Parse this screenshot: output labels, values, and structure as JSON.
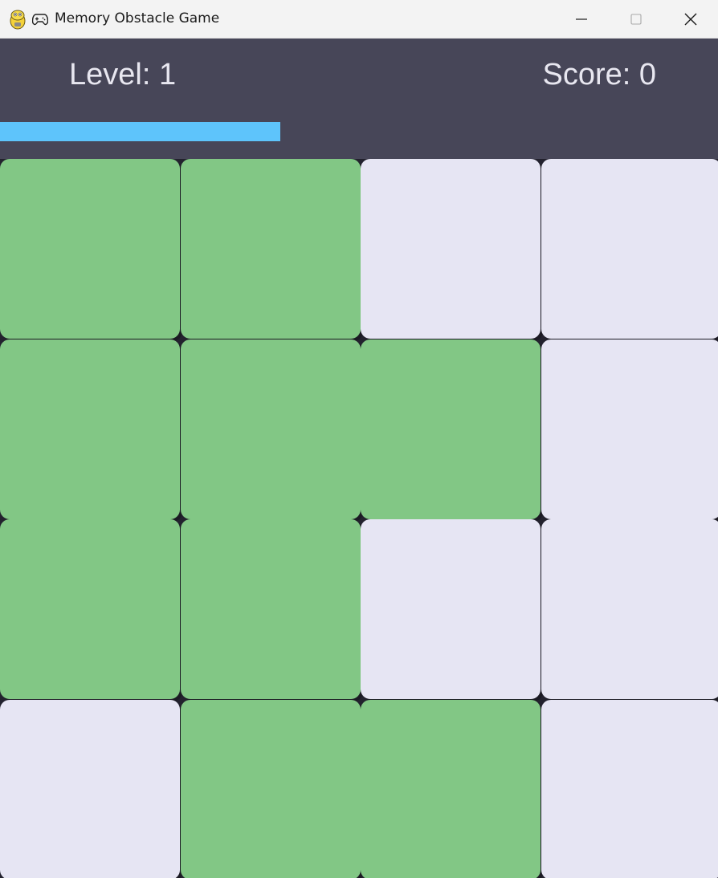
{
  "window": {
    "title": "Memory Obstacle Game",
    "app_icon": "pygame-snake-icon",
    "title_icon": "gamepad-icon",
    "controls": [
      "minimize-icon",
      "maximize-icon",
      "close-icon"
    ]
  },
  "hud": {
    "level_text": "Level: 1",
    "score_text": "Score: 0",
    "timer_progress": 0.39,
    "timer_color": "#5ec4fb"
  },
  "colors": {
    "hud_background": "#474658",
    "grid_background": "#23222e",
    "path_tile": "#82c785",
    "obstacle_tile": "#e6e5f3"
  },
  "grid": {
    "rows": 4,
    "cols": 4,
    "cells": [
      [
        "path",
        "path",
        "wall",
        "wall"
      ],
      [
        "path",
        "path",
        "path",
        "wall"
      ],
      [
        "path",
        "path",
        "wall",
        "wall"
      ],
      [
        "wall",
        "path",
        "path",
        "wall"
      ]
    ]
  }
}
